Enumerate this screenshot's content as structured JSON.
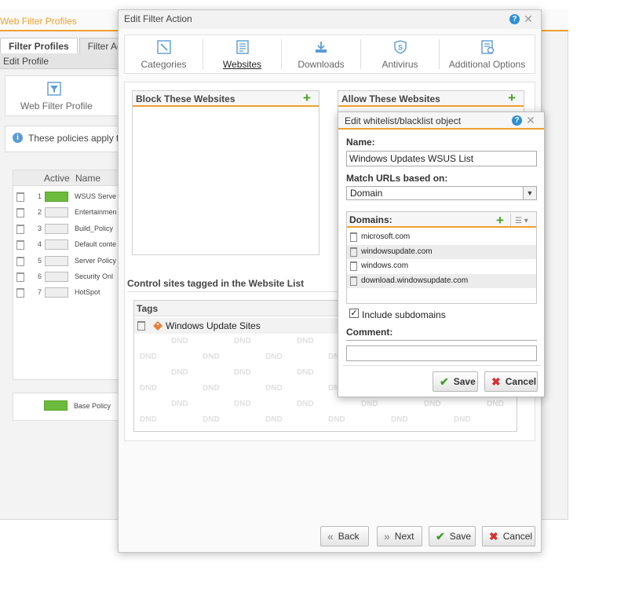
{
  "background": {
    "window_title": "Web Filter Profiles",
    "tabs": [
      "Filter Profiles",
      "Filter Acti"
    ],
    "subtab": "Edit Profile",
    "panel_label": "Web Filter Profile",
    "note": "These policies apply to",
    "table": {
      "columns": [
        "Active",
        "Name"
      ],
      "rows": [
        {
          "num": "1",
          "name": "WSUS Serve",
          "active": true
        },
        {
          "num": "2",
          "name": "Entertainmen",
          "active": false
        },
        {
          "num": "3",
          "name": "Build_Policy",
          "active": false
        },
        {
          "num": "4",
          "name": "Default conte",
          "active": false
        },
        {
          "num": "5",
          "name": "Server Policy",
          "active": false
        },
        {
          "num": "6",
          "name": "Security Onl",
          "active": false
        },
        {
          "num": "7",
          "name": "HotSpot",
          "active": false
        }
      ]
    },
    "base_policy": "Base Policy"
  },
  "dialog": {
    "title": "Edit Filter Action",
    "tabs": [
      {
        "label": "Categories",
        "icon": "categories-icon"
      },
      {
        "label": "Websites",
        "icon": "websites-icon"
      },
      {
        "label": "Downloads",
        "icon": "downloads-icon"
      },
      {
        "label": "Antivirus",
        "icon": "antivirus-icon"
      },
      {
        "label": "Additional Options",
        "icon": "additional-options-icon"
      }
    ],
    "active_tab": "Websites",
    "block_title": "Block These Websites",
    "allow_title": "Allow These Websites",
    "control_title": "Control sites tagged in the Website List",
    "tags_header": "Tags",
    "tags": [
      "Windows Update Sites"
    ],
    "dnd_text": "DND",
    "buttons": {
      "back": "Back",
      "next": "Next",
      "save": "Save",
      "cancel": "Cancel"
    }
  },
  "subdialog": {
    "title": "Edit whitelist/blacklist object",
    "name_label": "Name:",
    "name_value": "Windows Updates WSUS List",
    "match_label": "Match URLs based on:",
    "match_value": "Domain",
    "domains_label": "Domains:",
    "domains": [
      "microsoft.com",
      "windowsupdate.com",
      "windows.com",
      "download.windowsupdate.com"
    ],
    "include_subdomains_label": "Include subdomains",
    "include_subdomains": true,
    "comment_label": "Comment:",
    "comment_value": "",
    "save_label": "Save",
    "cancel_label": "Cancel"
  },
  "colors": {
    "accent": "#f0a030",
    "green": "#3c9f2a",
    "red": "#d23333",
    "help_blue": "#2f8fd5"
  }
}
